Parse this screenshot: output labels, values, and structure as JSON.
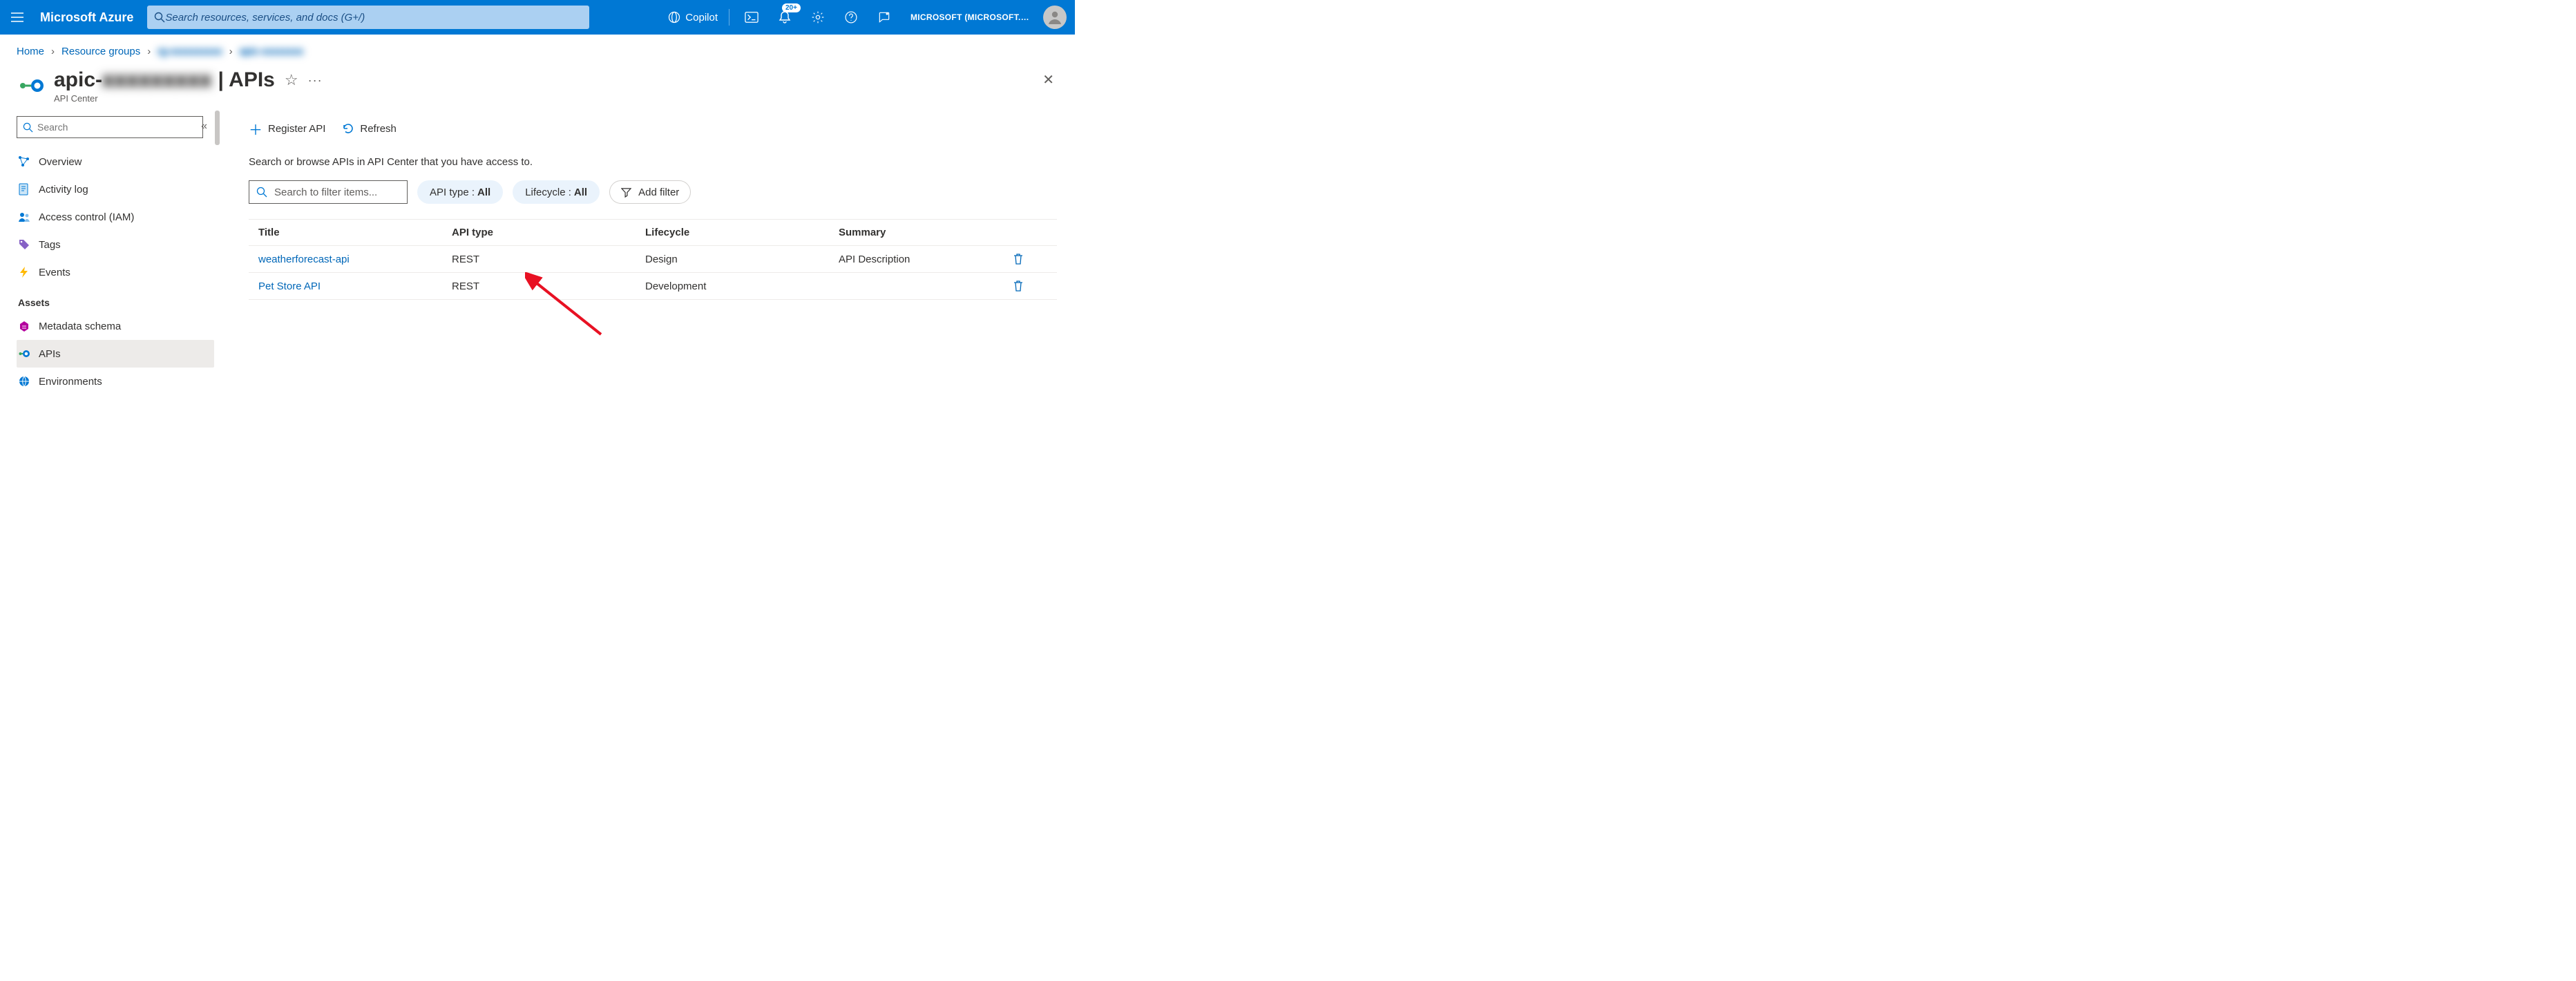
{
  "header": {
    "brand": "Microsoft Azure",
    "search_placeholder": "Search resources, services, and docs (G+/)",
    "copilot_label": "Copilot",
    "notification_badge": "20+",
    "account_label": "MICROSOFT (MICROSOFT.ONMI..."
  },
  "breadcrumbs": {
    "home": "Home",
    "rg_label": "Resource groups",
    "rg_name": "rg-xxxxxxxxxx",
    "res_name": "apic-xxxxxxxx"
  },
  "page": {
    "title_prefix": "apic-",
    "title_blur": "xxxxxxxxx",
    "title_suffix": " | APIs",
    "subtitle": "API Center"
  },
  "sidebar": {
    "search_placeholder": "Search",
    "items": [
      {
        "label": "Overview"
      },
      {
        "label": "Activity log"
      },
      {
        "label": "Access control (IAM)"
      },
      {
        "label": "Tags"
      },
      {
        "label": "Events"
      }
    ],
    "group_assets": "Assets",
    "assets": [
      {
        "label": "Metadata schema"
      },
      {
        "label": "APIs"
      },
      {
        "label": "Environments"
      }
    ]
  },
  "toolbar": {
    "register": "Register API",
    "refresh": "Refresh"
  },
  "main": {
    "description": "Search or browse APIs in API Center that you have access to.",
    "filter_placeholder": "Search to filter items...",
    "pill_apitype_label": "API type : ",
    "pill_apitype_value": "All",
    "pill_lifecycle_label": "Lifecycle : ",
    "pill_lifecycle_value": "All",
    "add_filter": "Add filter"
  },
  "table": {
    "headers": {
      "title": "Title",
      "apitype": "API type",
      "lifecycle": "Lifecycle",
      "summary": "Summary"
    },
    "rows": [
      {
        "title": "weatherforecast-api",
        "apitype": "REST",
        "lifecycle": "Design",
        "summary": "API Description"
      },
      {
        "title": "Pet Store API",
        "apitype": "REST",
        "lifecycle": "Development",
        "summary": ""
      }
    ]
  }
}
